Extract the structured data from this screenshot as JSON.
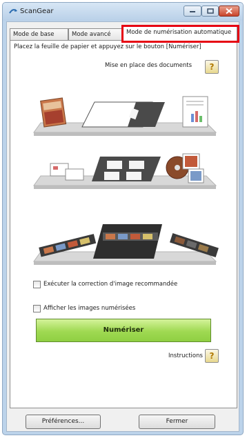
{
  "window": {
    "title": "ScanGear"
  },
  "tabs": [
    {
      "label": "Mode de base",
      "selected": false
    },
    {
      "label": "Mode avancé",
      "selected": false
    },
    {
      "label": "Mode de numérisation automatique",
      "selected": true
    }
  ],
  "panel": {
    "instruction": "Placez la feuille de papier et appuyez sur le bouton [Numériser]",
    "placement_label": "Mise en place des documents",
    "help_glyph": "?",
    "checkbox_correction": {
      "label": "Exécuter la correction d'image recommandée",
      "checked": false
    },
    "checkbox_show": {
      "label": "Afficher les images numérisées",
      "checked": false
    },
    "scan_button": "Numériser",
    "instructions_label": "Instructions"
  },
  "footer": {
    "preferences_button": "Préférences...",
    "close_button": "Fermer"
  },
  "colors": {
    "highlight": "#e60012",
    "scan_button": "#9fd952",
    "window_frame": "#bcd3ea"
  },
  "icons": [
    "scangear-app-icon",
    "minimize-icon",
    "maximize-icon",
    "close-icon",
    "help-icon"
  ]
}
